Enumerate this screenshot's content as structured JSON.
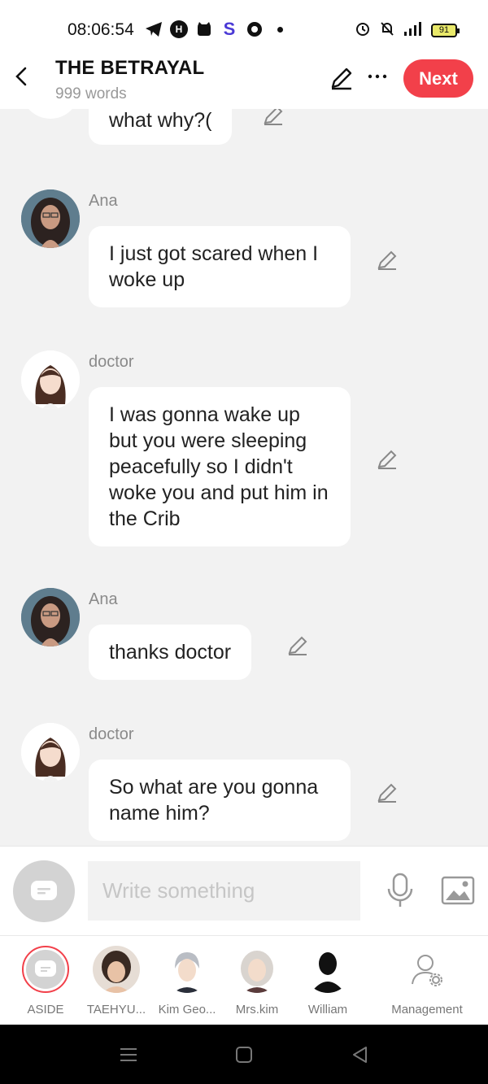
{
  "status_bar": {
    "time": "08:06:54",
    "battery": "91"
  },
  "header": {
    "title": "THE BETRAYAL",
    "word_count": "999 words",
    "next_label": "Next"
  },
  "messages": [
    {
      "sender": "",
      "text": "what why?("
    },
    {
      "sender": "Ana",
      "text": "I just got scared when I woke up"
    },
    {
      "sender": "doctor",
      "text": "I was gonna wake up but you were sleeping peacefully so I didn't woke you and put him in the Crib"
    },
    {
      "sender": "Ana",
      "text": "thanks doctor"
    },
    {
      "sender": "doctor",
      "text": "So what are you gonna name him?"
    }
  ],
  "input": {
    "placeholder": "Write something"
  },
  "characters": [
    {
      "label": "ASIDE"
    },
    {
      "label": "TAEHYU..."
    },
    {
      "label": "Kim Geo..."
    },
    {
      "label": "Mrs.kim"
    },
    {
      "label": "William"
    },
    {
      "label": "Management"
    }
  ],
  "colors": {
    "accent": "#f2404a",
    "bubble": "#ffffff",
    "chat_background": "#f2f2f2"
  }
}
